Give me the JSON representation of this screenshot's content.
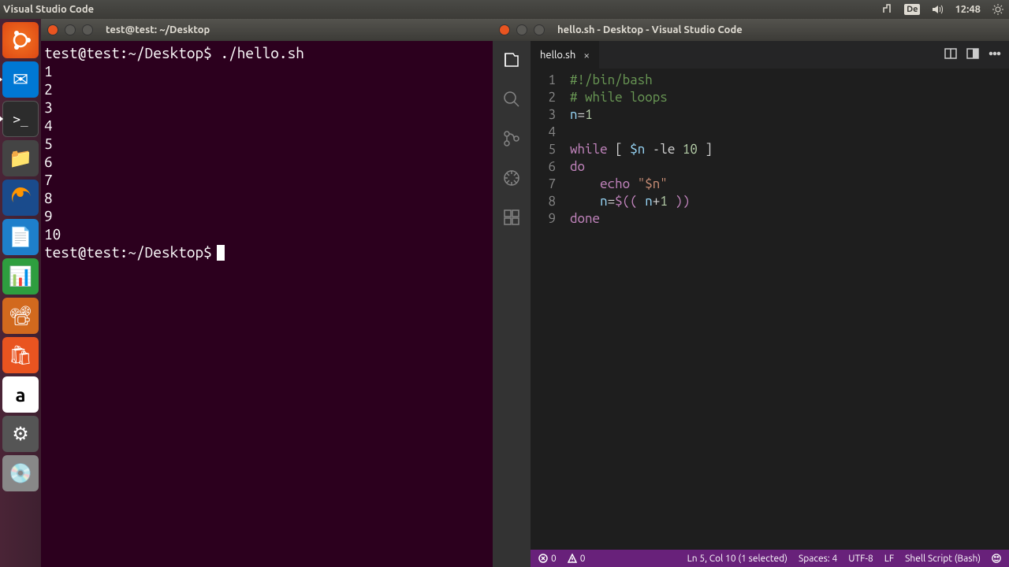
{
  "top_panel": {
    "title": "Visual Studio Code",
    "keyboard": "De",
    "clock": "12:48"
  },
  "terminal": {
    "title": "test@test: ~/Desktop",
    "prompt": "test@test:~/Desktop$",
    "command": "./hello.sh",
    "output": [
      "1",
      "2",
      "3",
      "4",
      "5",
      "6",
      "7",
      "8",
      "9",
      "10"
    ]
  },
  "vscode": {
    "window_title": "hello.sh - Desktop - Visual Studio Code",
    "tab": {
      "label": "hello.sh"
    },
    "code_lines": [
      {
        "n": 1,
        "t": "#!/bin/bash",
        "cls": "c-comment"
      },
      {
        "n": 2,
        "t": "# while loops",
        "cls": "c-comment"
      },
      {
        "n": 3,
        "raw": true
      },
      {
        "n": 4,
        "t": "",
        "cls": ""
      },
      {
        "n": 5,
        "raw": true
      },
      {
        "n": 6,
        "t": "do",
        "cls": "c-keyword"
      },
      {
        "n": 7,
        "raw": true
      },
      {
        "n": 8,
        "raw": true
      },
      {
        "n": 9,
        "t": "done",
        "cls": "c-keyword"
      }
    ],
    "status": {
      "errors": "0",
      "warnings": "0",
      "position": "Ln 5, Col 10 (1 selected)",
      "spaces": "Spaces: 4",
      "encoding": "UTF-8",
      "eol": "LF",
      "language": "Shell Script (Bash)"
    }
  }
}
